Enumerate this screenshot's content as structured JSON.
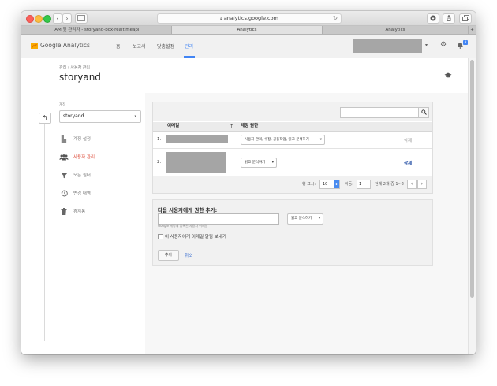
{
  "browser": {
    "url": "analytics.google.com",
    "tabs": [
      {
        "label": "IAM 및 관리자 - storyand-box-realtimeapi",
        "active": false
      },
      {
        "label": "Analytics",
        "active": true
      },
      {
        "label": "Analytics",
        "active": false
      }
    ],
    "buttons": {
      "back": "‹",
      "forward": "›",
      "reload": "↻",
      "plus": "+"
    }
  },
  "header": {
    "brand": "Google Analytics",
    "nav": [
      "홈",
      "보고서",
      "맞춤설정",
      "관리"
    ],
    "active_nav": "관리",
    "notification_count": "5"
  },
  "page": {
    "breadcrumb": "관리 › 사용자 관리",
    "title": "storyand"
  },
  "sidebar": {
    "account_label": "계정",
    "account_value": "storyand",
    "items": [
      {
        "label": "계정 설정",
        "icon": "building-icon"
      },
      {
        "label": "사용자 관리",
        "icon": "users-icon",
        "active": true
      },
      {
        "label": "모든 필터",
        "icon": "filter-icon"
      },
      {
        "label": "변경 내역",
        "icon": "history-icon"
      },
      {
        "label": "휴지통",
        "icon": "trash-icon"
      }
    ]
  },
  "table": {
    "headers": {
      "email": "이메일",
      "permission": "계정 권한"
    },
    "rows": [
      {
        "num": "1.",
        "permission": "사용자 관리, 수정, 공동작업, 읽고 분석하기",
        "delete": "삭제"
      },
      {
        "num": "2.",
        "permission": "읽고 분석하기",
        "delete": "삭제"
      }
    ],
    "pagination": {
      "rows_label": "행 표시:",
      "rows_value": "10",
      "goto_label": "이동:",
      "goto_value": "1",
      "range": "전체 2개 중 1~2"
    }
  },
  "add_user": {
    "title": "다음 사용자에게 권한 추가:",
    "email_placeholder": "",
    "hint": "Google 계정에 등록된 사용자 이메일",
    "permission_value": "읽고 분석하기",
    "notify_label": "이 사용자에게 이메일 알림 보내기",
    "add_button": "추가",
    "cancel": "취소"
  },
  "colors": {
    "accent": "#4285f4",
    "active_menu": "#dd4b39",
    "delete_active": "#1a47a0",
    "delete_muted": "#999999"
  }
}
